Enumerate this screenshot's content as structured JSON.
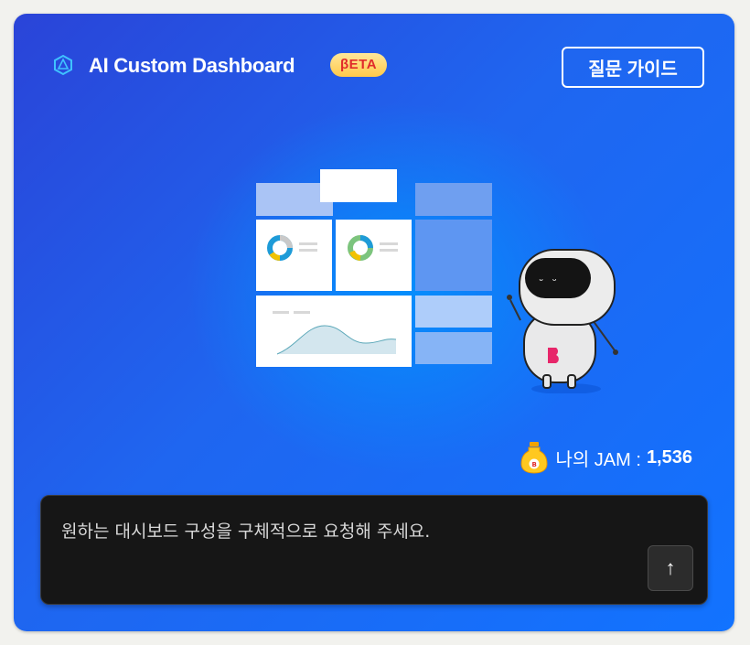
{
  "header": {
    "title": "AI Custom Dashboard",
    "badge": "βETA",
    "guide_button": "질문 가이드"
  },
  "jam": {
    "label": "나의 JAM :",
    "value": "1,536"
  },
  "prompt": {
    "placeholder": "원하는 대시보드 구성을 구체적으로 요청해 주세요.",
    "send_icon": "↑"
  },
  "colors": {
    "accent": "#1f66f0",
    "badge_text": "#e02b2b",
    "input_bg": "#161616"
  }
}
